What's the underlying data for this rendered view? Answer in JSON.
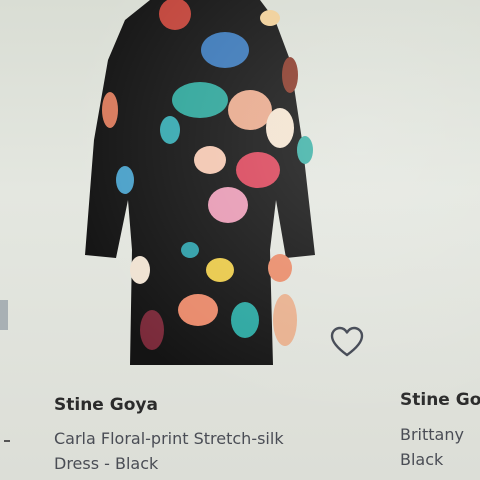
{
  "products": [
    {
      "brand": "Stine Goya",
      "name_line1": "Carla Floral-print Stretch-silk",
      "name_line2": "Dress - Black",
      "wishlist_icon": "heart-outline-icon",
      "image": "dress-floral-icon"
    },
    {
      "brand": "Stine Go",
      "name_line1": "Brittany",
      "name_line2": "Black"
    }
  ],
  "colors": {
    "dress_base": "#141414",
    "text_brand": "#2b2b2b",
    "text_name": "#4a4d55"
  }
}
